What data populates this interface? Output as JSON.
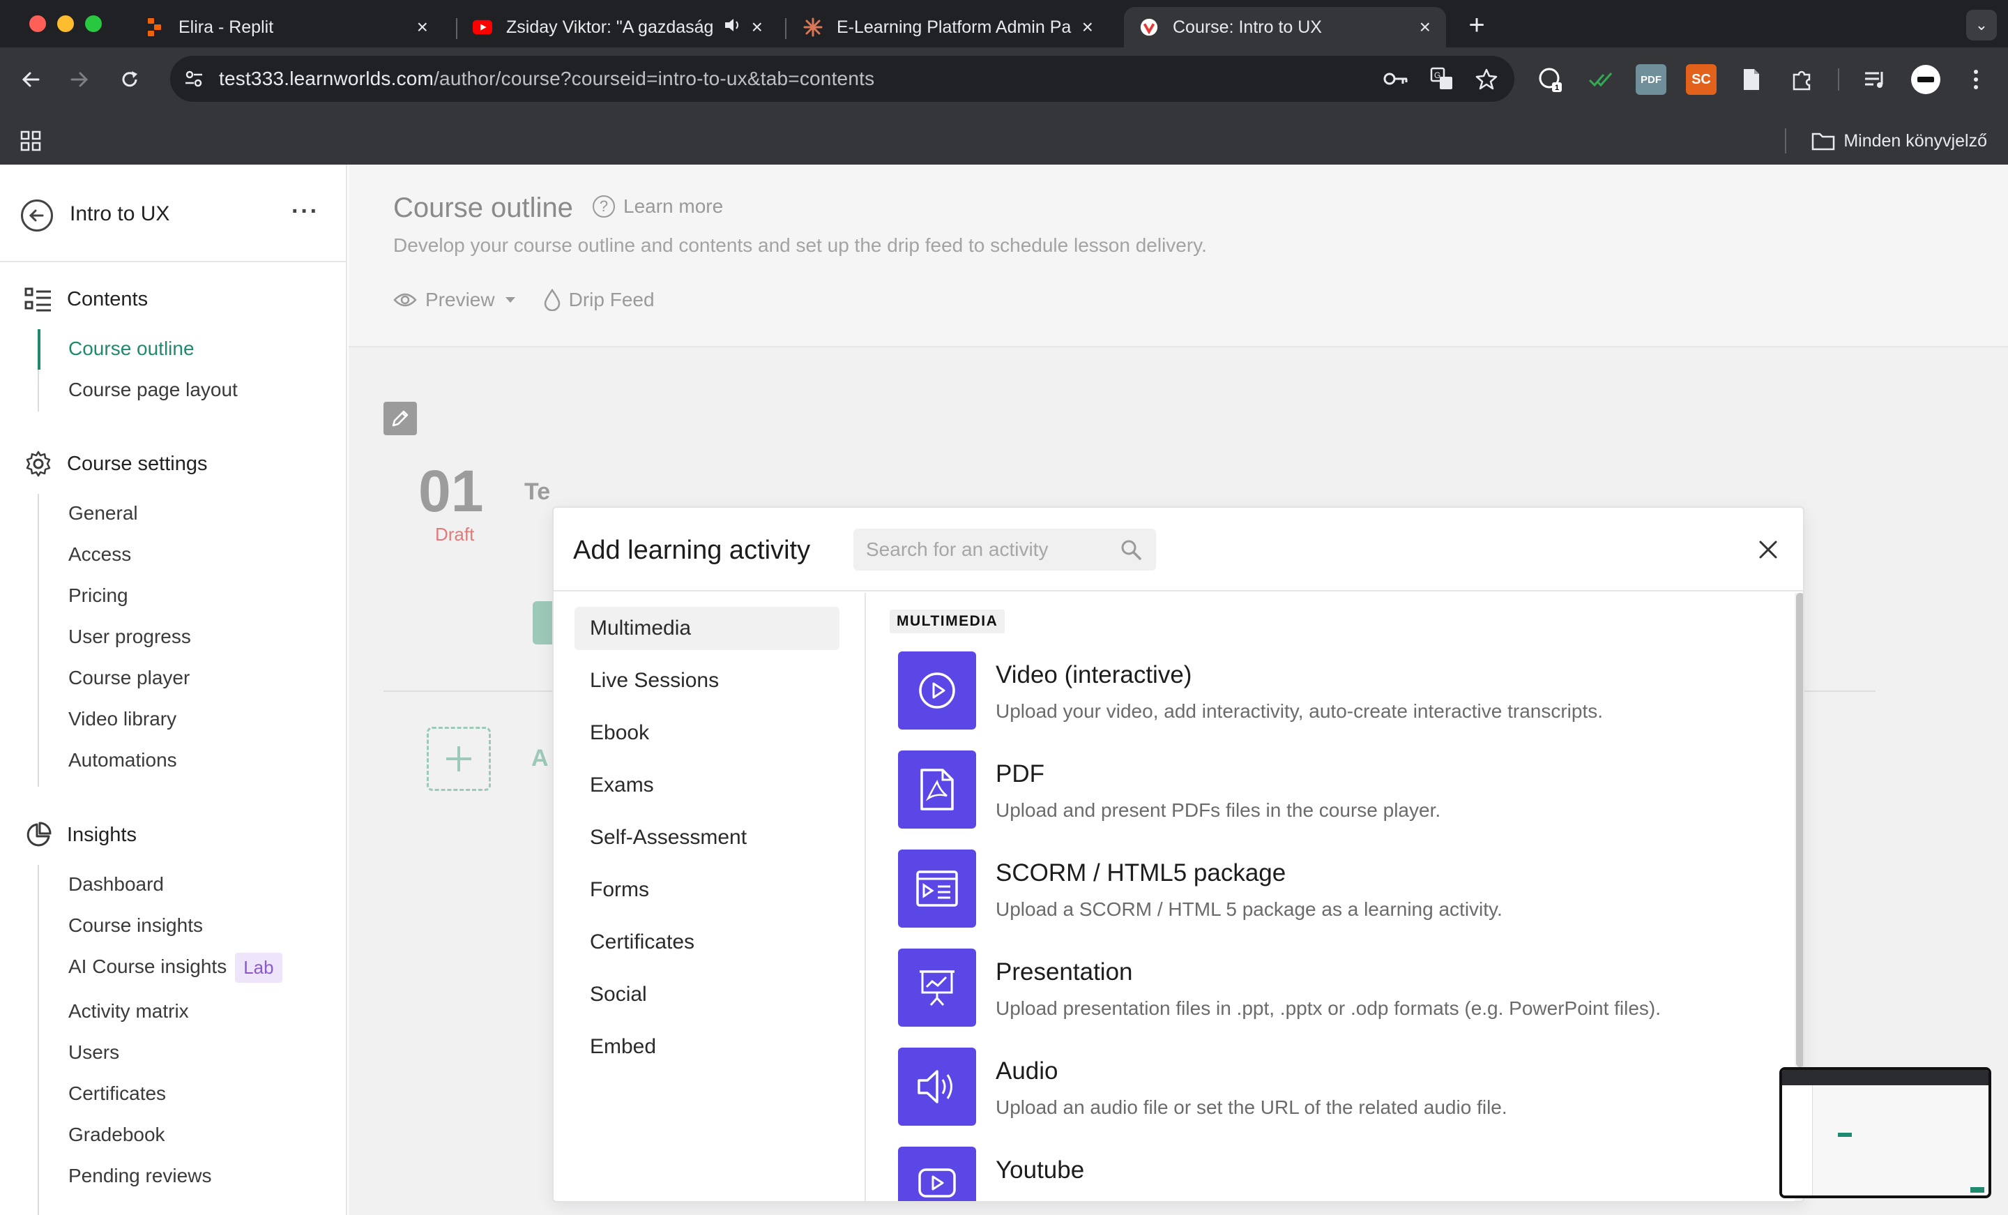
{
  "browser": {
    "tabs": [
      {
        "title": "Elira - Replit"
      },
      {
        "title": "Zsiday Viktor: \"A gazdaság"
      },
      {
        "title": "E-Learning Platform Admin Pa"
      },
      {
        "title": "Course: Intro to UX"
      }
    ],
    "url_host": "test333.learnworlds.com",
    "url_path": "/author/course?courseid=intro-to-ux&tab=contents",
    "bookmarks_label": "Minden könyvjelző",
    "extensions": [
      {
        "name": "pdf",
        "label": "PDF",
        "color": "#6f8f9a"
      },
      {
        "name": "sc",
        "label": "SC",
        "color": "#e2621b"
      }
    ],
    "colors": {
      "chrome_dark": "#202124",
      "chrome_toolbar": "#35363a",
      "accent_green": "#1f8a70",
      "activity_purple": "#5b47e6"
    }
  },
  "sidebar": {
    "course_title": "Intro to UX",
    "contents": {
      "heading": "Contents",
      "items": [
        "Course outline",
        "Course page layout"
      ]
    },
    "settings": {
      "heading": "Course settings",
      "items": [
        "General",
        "Access",
        "Pricing",
        "User progress",
        "Course player",
        "Video library",
        "Automations"
      ]
    },
    "insights": {
      "heading": "Insights",
      "items": [
        "Dashboard",
        "Course insights",
        "AI Course insights",
        "Activity matrix",
        "Users",
        "Certificates",
        "Gradebook",
        "Pending reviews"
      ],
      "lab_badge": "Lab"
    }
  },
  "main": {
    "title": "Course outline",
    "learn_more": "Learn more",
    "subtitle": "Develop your course outline and contents and set up the drip feed to schedule lesson delivery.",
    "preview": "Preview",
    "drip_feed": "Drip Feed",
    "section_number": "01",
    "section_status": "Draft",
    "section_title_partial": "Te",
    "add_text_partial": "A"
  },
  "modal": {
    "title": "Add learning activity",
    "search_placeholder": "Search for an activity",
    "categories": [
      "Multimedia",
      "Live Sessions",
      "Ebook",
      "Exams",
      "Self-Assessment",
      "Forms",
      "Certificates",
      "Social",
      "Embed"
    ],
    "active_category": "Multimedia",
    "section_label": "MULTIMEDIA",
    "activities": [
      {
        "icon": "play-circle-icon",
        "title": "Video (interactive)",
        "desc": "Upload your video, add interactivity, auto-create interactive transcripts."
      },
      {
        "icon": "pdf-file-icon",
        "title": "PDF",
        "desc": "Upload and present PDFs files in the course player."
      },
      {
        "icon": "scorm-package-icon",
        "title": "SCORM / HTML5 package",
        "desc": "Upload a SCORM / HTML 5 package as a learning activity."
      },
      {
        "icon": "presentation-icon",
        "title": "Presentation",
        "desc": "Upload presentation files in .ppt, .pptx or .odp formats (e.g. PowerPoint files)."
      },
      {
        "icon": "audio-icon",
        "title": "Audio",
        "desc": "Upload an audio file or set the URL of the related audio file."
      },
      {
        "icon": "youtube-icon",
        "title": "Youtube",
        "desc": ""
      }
    ]
  }
}
